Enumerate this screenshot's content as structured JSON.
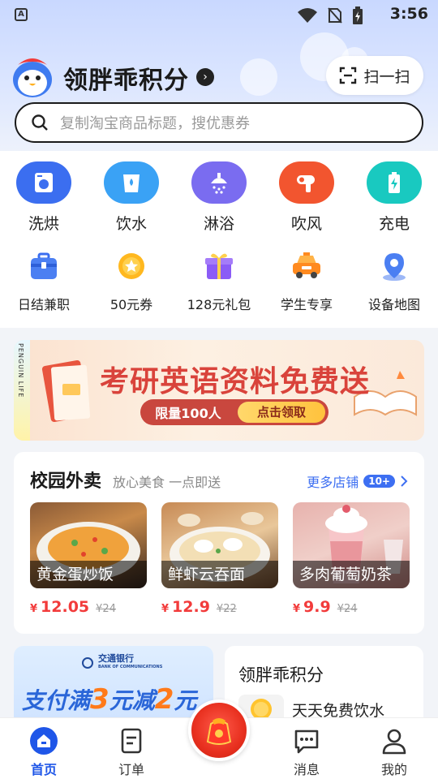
{
  "status_bar": {
    "time": "3:56",
    "app_badge": "A"
  },
  "header": {
    "title": "领胖乖积分",
    "scan_label": "扫一扫",
    "search_placeholder": "复制淘宝商品标题，搜优惠券"
  },
  "services": [
    {
      "label": "洗烘",
      "icon": "washer-icon",
      "color": "#3b6ef0"
    },
    {
      "label": "饮水",
      "icon": "water-cup-icon",
      "color": "#3aa2f5"
    },
    {
      "label": "淋浴",
      "icon": "shower-icon",
      "color": "#7a6cf0"
    },
    {
      "label": "吹风",
      "icon": "hair-dryer-icon",
      "color": "#f2552f"
    },
    {
      "label": "充电",
      "icon": "battery-charge-icon",
      "color": "#19c9c0"
    }
  ],
  "shortcuts": [
    {
      "label": "日结兼职",
      "icon": "briefcase-icon"
    },
    {
      "label": "50元券",
      "icon": "coupon-medal-icon"
    },
    {
      "label": "128元礼包",
      "icon": "gift-box-icon"
    },
    {
      "label": "学生专享",
      "icon": "taxi-icon"
    },
    {
      "label": "设备地图",
      "icon": "map-pin-icon"
    }
  ],
  "banner": {
    "side_text": "PENGUIN LIFE",
    "title": "考研英语资料免费送",
    "pill_left": "限量100人",
    "pill_right": "点击领取"
  },
  "food_section": {
    "title": "校园外卖",
    "subtitle": "放心美食 一点即送",
    "more_label": "更多店铺",
    "more_badge": "10+",
    "items": [
      {
        "name": "黄金蛋炒饭",
        "currency": "¥",
        "price": "12.05",
        "old_price": "¥24"
      },
      {
        "name": "鲜虾云吞面",
        "currency": "¥",
        "price": "12.9",
        "old_price": "¥22"
      },
      {
        "name": "多肉葡萄奶茶",
        "currency": "¥",
        "price": "9.9",
        "old_price": "¥24"
      }
    ]
  },
  "promo_card": {
    "bank_name": "交通银行",
    "bank_name_en": "BANK OF COMMUNICATIONS",
    "text_a": "支付满",
    "num_a": "3",
    "text_b": "元减",
    "num_b": "2",
    "text_c": "元"
  },
  "points_card": {
    "title": "领胖乖积分",
    "item": "天天免费饮水"
  },
  "tabbar": {
    "tabs": [
      {
        "label": "首页",
        "active": true
      },
      {
        "label": "订单",
        "active": false
      },
      {
        "label": "消息",
        "active": false
      },
      {
        "label": "我的",
        "active": false
      }
    ]
  }
}
